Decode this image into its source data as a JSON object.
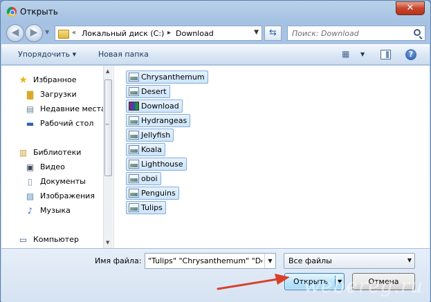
{
  "window": {
    "title": "Открыть",
    "close_label": "✕"
  },
  "address_bar": {
    "prefix": "«",
    "segments": [
      "Локальный диск (C:)",
      "Download"
    ],
    "separator": "▸"
  },
  "search": {
    "placeholder": "Поиск: Download"
  },
  "toolbar": {
    "organize_label": "Упорядочить ▾",
    "new_folder_label": "Новая папка",
    "help_label": "?"
  },
  "nav_pane": {
    "items": [
      {
        "label": "Избранное",
        "icon": "star-icon"
      },
      {
        "label": "Загрузки",
        "icon": "downloads-folder-icon"
      },
      {
        "label": "Недавние места",
        "icon": "recent-places-icon"
      },
      {
        "label": "Рабочий стол",
        "icon": "desktop-icon"
      },
      {
        "label": "Библиотеки",
        "icon": "libraries-icon"
      },
      {
        "label": "Видео",
        "icon": "video-icon"
      },
      {
        "label": "Документы",
        "icon": "documents-icon"
      },
      {
        "label": "Изображения",
        "icon": "pictures-icon"
      },
      {
        "label": "Музыка",
        "icon": "music-icon"
      },
      {
        "label": "Компьютер",
        "icon": "computer-icon"
      }
    ]
  },
  "files": [
    {
      "name": "Chrysanthemum",
      "icon": "image-file-icon"
    },
    {
      "name": "Desert",
      "icon": "image-file-icon"
    },
    {
      "name": "Download",
      "icon": "archive-file-icon"
    },
    {
      "name": "Hydrangeas",
      "icon": "image-file-icon"
    },
    {
      "name": "Jellyfish",
      "icon": "image-file-icon"
    },
    {
      "name": "Koala",
      "icon": "image-file-icon"
    },
    {
      "name": "Lighthouse",
      "icon": "image-file-icon"
    },
    {
      "name": "oboi",
      "icon": "image-file-icon"
    },
    {
      "name": "Penguins",
      "icon": "image-file-icon"
    },
    {
      "name": "Tulips",
      "icon": "image-file-icon"
    }
  ],
  "bottom": {
    "filename_label": "Имя файла:",
    "filename_value": "\"Tulips\" \"Chrysanthemum\" \"Des",
    "filetype_value": "Все файлы",
    "open_label": "Открыть",
    "cancel_label": "Отмена"
  },
  "watermark": "webereg.ru",
  "colors": {
    "arrow": "#d8402a",
    "selection": "#cde5fb",
    "selection_border": "#84acdd"
  }
}
